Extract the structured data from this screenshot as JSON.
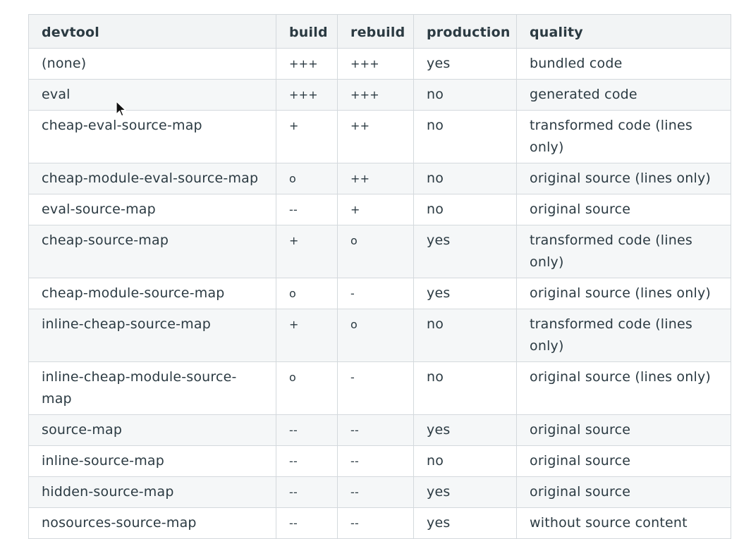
{
  "table": {
    "headers": [
      "devtool",
      "build",
      "rebuild",
      "production",
      "quality"
    ],
    "rows": [
      [
        "(none)",
        "+++",
        "+++",
        "yes",
        "bundled code"
      ],
      [
        "eval",
        "+++",
        "+++",
        "no",
        "generated code"
      ],
      [
        "cheap-eval-source-map",
        "+",
        "++",
        "no",
        "transformed code (lines only)"
      ],
      [
        "cheap-module-eval-source-map",
        "o",
        "++",
        "no",
        "original source (lines only)"
      ],
      [
        "eval-source-map",
        "--",
        "+",
        "no",
        "original source"
      ],
      [
        "cheap-source-map",
        "+",
        "o",
        "yes",
        "transformed code (lines only)"
      ],
      [
        "cheap-module-source-map",
        "o",
        "-",
        "yes",
        "original source (lines only)"
      ],
      [
        "inline-cheap-source-map",
        "+",
        "o",
        "no",
        "transformed code (lines only)"
      ],
      [
        "inline-cheap-module-source-map",
        "o",
        "-",
        "no",
        "original source (lines only)"
      ],
      [
        "source-map",
        "--",
        "--",
        "yes",
        "original source"
      ],
      [
        "inline-source-map",
        "--",
        "--",
        "no",
        "original source"
      ],
      [
        "hidden-source-map",
        "--",
        "--",
        "yes",
        "original source"
      ],
      [
        "nosources-source-map",
        "--",
        "--",
        "yes",
        "without source content"
      ]
    ]
  },
  "icons": {
    "cursor": "mouse-pointer-icon"
  }
}
